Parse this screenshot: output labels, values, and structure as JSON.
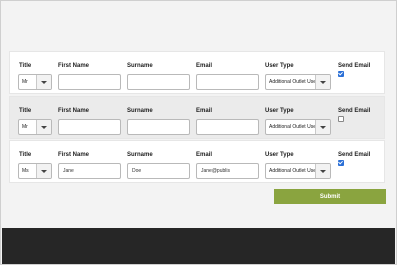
{
  "form": {
    "labels": {
      "title": "Title",
      "first_name": "First Name",
      "surname": "Surname",
      "email": "Email",
      "user_type": "User Type",
      "send_email": "Send Email"
    },
    "rows": [
      {
        "title": "Mr",
        "first_name": "",
        "surname": "",
        "email": "",
        "user_type": "Additional Outlet User",
        "send_email": true
      },
      {
        "title": "Mr",
        "first_name": "",
        "surname": "",
        "email": "",
        "user_type": "Additional Outlet User",
        "send_email": false
      },
      {
        "title": "Ms",
        "first_name": "Jane",
        "surname": "Doe",
        "email": "Jane@publis",
        "user_type": "Additional Outlet User",
        "send_email": true
      }
    ],
    "submit_label": "Submit"
  },
  "colors": {
    "accent": "#8aa43f",
    "footer": "#262626",
    "alt_row": "#ebebeb"
  }
}
